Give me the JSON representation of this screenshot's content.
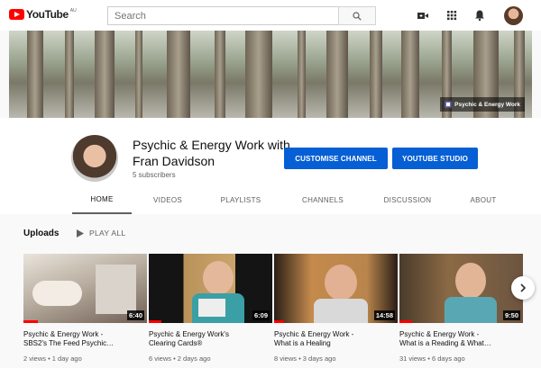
{
  "masthead": {
    "logo_text": "YouTube",
    "region": "AU",
    "search_placeholder": "Search",
    "icons": [
      "create-video-icon",
      "apps-grid-icon",
      "notifications-bell-icon"
    ]
  },
  "banner": {
    "link_label": "Psychic & Energy Work"
  },
  "channel": {
    "title": "Psychic & Energy Work with Fran Davidson",
    "subscribers": "5 subscribers",
    "customise_label": "CUSTOMISE CHANNEL",
    "studio_label": "YOUTUBE STUDIO"
  },
  "tabs": [
    {
      "label": "HOME",
      "active": true
    },
    {
      "label": "VIDEOS",
      "active": false
    },
    {
      "label": "PLAYLISTS",
      "active": false
    },
    {
      "label": "CHANNELS",
      "active": false
    },
    {
      "label": "DISCUSSION",
      "active": false
    },
    {
      "label": "ABOUT",
      "active": false
    }
  ],
  "uploads": {
    "title": "Uploads",
    "play_all_label": "PLAY ALL",
    "videos": [
      {
        "title_line1": "Psychic & Energy Work -",
        "title_line2": "SBS2's The Feed Psychic…",
        "duration": "6:40",
        "meta": "2 views • 1 day ago"
      },
      {
        "title_line1": "Psychic & Energy Work's",
        "title_line2": "Clearing Cards®",
        "duration": "6:09",
        "meta": "6 views • 2 days ago"
      },
      {
        "title_line1": "Psychic & Energy Work -",
        "title_line2": "What is a Healing",
        "duration": "14:58",
        "meta": "8 views • 3 days ago"
      },
      {
        "title_line1": "Psychic & Energy Work -",
        "title_line2": "What is a Reading & What…",
        "duration": "9:50",
        "meta": "31 views • 6 days ago"
      }
    ]
  },
  "colors": {
    "brand_red": "#ff0000",
    "button_blue": "#065fd4",
    "secondary_text": "#606060"
  }
}
